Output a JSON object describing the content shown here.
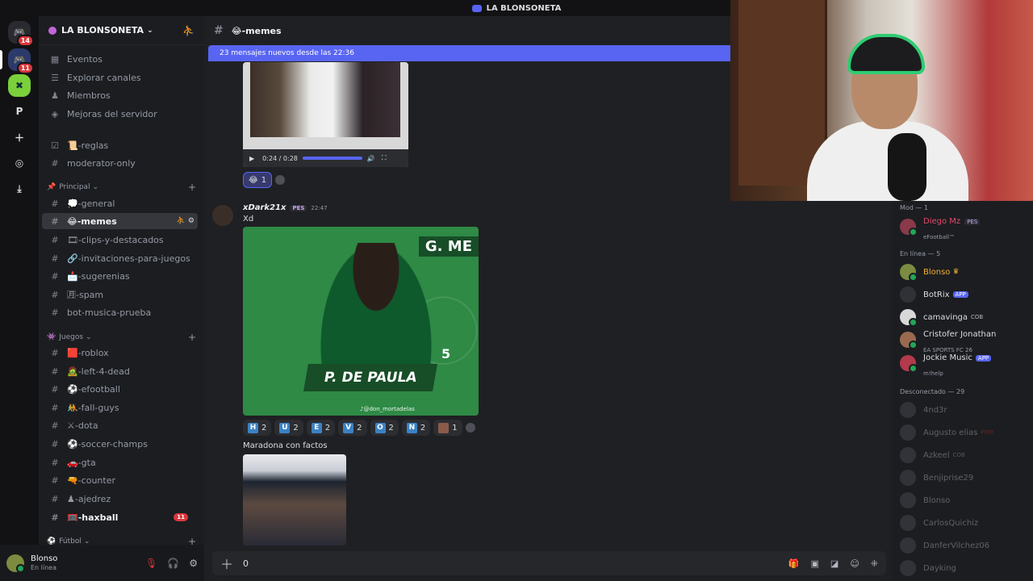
{
  "window": {
    "title": "LA BLONSONETA"
  },
  "servers": {
    "items": [
      {
        "name": "discord-home",
        "badge": "14"
      },
      {
        "name": "server-1",
        "badge": "11"
      },
      {
        "name": "server-2",
        "badge": ""
      },
      {
        "name": "P",
        "badge": ""
      }
    ]
  },
  "sidebar": {
    "server_name": "LA BLONSONETA",
    "nav": {
      "events": "Eventos",
      "browse": "Explorar canales",
      "members": "Miembros",
      "boosts": "Mejoras del servidor"
    },
    "top_channels": {
      "reglas": "📜-reglas",
      "moderator": "moderator-only"
    },
    "categories": {
      "principal": "Principal",
      "juegos": "Juegos",
      "futbol": "Fútbol"
    },
    "principal_channels": {
      "general": "💭-general",
      "memes": "😂-memes",
      "clips": "🎞-clips-y-destacados",
      "invitaciones": "🔗-invitaciones-para-juegos",
      "sugerencias": "📩-sugerenias",
      "spam": "🈷-spam",
      "bot": "bot-musica-prueba"
    },
    "juegos_channels": {
      "roblox": "🟥-roblox",
      "l4d": "🧟-left-4-dead",
      "efootball": "⚽-efootball",
      "fallguys": "🤼-fall-guys",
      "dota": "⚔-dota",
      "soccer": "⚽-soccer-champs",
      "gta": "🚗-gta",
      "counter": "🔫-counter",
      "ajedrez": "♟-ajedrez",
      "haxball": "🥅-haxball",
      "haxball_badge": "11"
    }
  },
  "user": {
    "name": "Blonso",
    "status": "En línea"
  },
  "channel": {
    "name": "😂-memes",
    "new_messages": "23 mensajes nuevos desde las 22:36",
    "video_time": "0:24 / 0:28",
    "first_reaction": {
      "emoji": "😂",
      "count": "1"
    },
    "message": {
      "author": "xDark21x",
      "tag": "PES",
      "time": "22:47",
      "text": "Xd",
      "image": {
        "title": "G. ME",
        "name": "P. DE PAULA",
        "number": "5",
        "watermark": "♪@don_mortadelas"
      },
      "reactions": [
        {
          "letter": "H",
          "count": "2"
        },
        {
          "letter": "U",
          "count": "2"
        },
        {
          "letter": "E",
          "count": "2"
        },
        {
          "letter": "V",
          "count": "2"
        },
        {
          "letter": "O",
          "count": "2"
        },
        {
          "letter": "N",
          "count": "2"
        },
        {
          "letter": "",
          "count": "1"
        }
      ],
      "text2": "Maradona con factos"
    },
    "composer_value": "0"
  },
  "members": {
    "mod_header": "Mod — 1",
    "mod": {
      "name": "Diego Mz",
      "tag": "PES",
      "activity": "eFootball™"
    },
    "online_header": "En línea — 5",
    "online": [
      {
        "name": "Blonso",
        "sub": "",
        "badge": ""
      },
      {
        "name": "BotRix",
        "sub": "",
        "badge": "APP"
      },
      {
        "name": "camavinga",
        "sub": "",
        "badge": "COB"
      },
      {
        "name": "Cristofer Jonathan",
        "sub": "EA SPORTS FC 26",
        "badge": ""
      },
      {
        "name": "Jockie Music",
        "sub": "m!help",
        "badge": "APP"
      }
    ],
    "offline_header": "Desconectado — 29",
    "offline": [
      {
        "name": "4nd3r",
        "badge": ""
      },
      {
        "name": "Augusto elias",
        "badge": "PIRR"
      },
      {
        "name": "Azkeel",
        "badge": "COB"
      },
      {
        "name": "Benjiprise29",
        "badge": ""
      },
      {
        "name": "Blonso",
        "badge": ""
      },
      {
        "name": "CarlosQuichiz",
        "badge": ""
      },
      {
        "name": "DanferVilchez06",
        "badge": ""
      },
      {
        "name": "Dayking",
        "badge": ""
      }
    ]
  }
}
